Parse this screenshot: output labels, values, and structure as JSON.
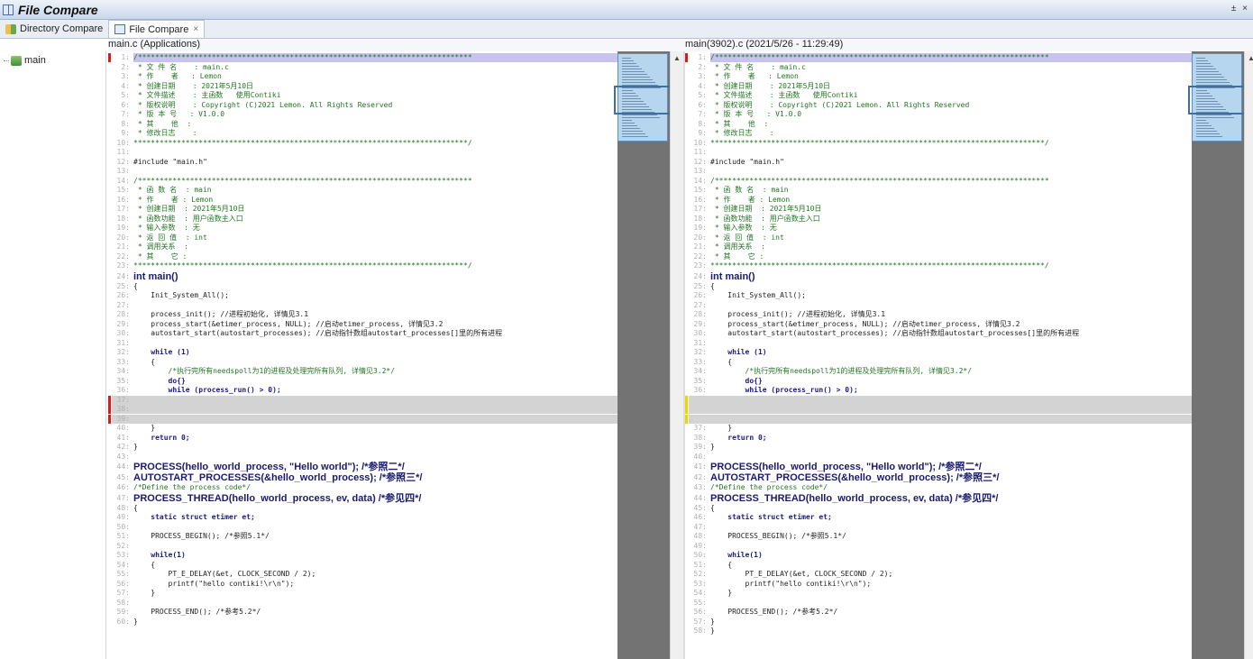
{
  "window": {
    "title": "File Compare",
    "controls": "± ×"
  },
  "tabs": [
    {
      "label": "Directory Compare"
    },
    {
      "label": "File Compare",
      "close": "×"
    }
  ],
  "left_header": "main.c (Applications)",
  "right_header": "main(3902).c (2021/5/26 - 11:29:49)",
  "tree": {
    "root": "main"
  },
  "left_lines": [
    {
      "n": "1:",
      "t": "/*****************************************************************************"
    },
    {
      "n": "2:",
      "t": " * 文 件 名    : main.c"
    },
    {
      "n": "3:",
      "t": " * 作    者   : Lemon"
    },
    {
      "n": "4:",
      "t": " * 创建日期    : 2021年5月10日"
    },
    {
      "n": "5:",
      "t": " * 文件描述    : 主函数   使用Contiki"
    },
    {
      "n": "6:",
      "t": " * 版权说明    : Copyright (C)2021 Lemon. All Rights Reserved"
    },
    {
      "n": "7:",
      "t": " * 版 本 号   : V1.0.0"
    },
    {
      "n": "8:",
      "t": " * 其    他  :"
    },
    {
      "n": "9:",
      "t": " * 修改日志    :"
    },
    {
      "n": "10:",
      "t": "*****************************************************************************/"
    },
    {
      "n": "11:",
      "t": ""
    },
    {
      "n": "12:",
      "t": "#include \"main.h\""
    },
    {
      "n": "13:",
      "t": ""
    },
    {
      "n": "14:",
      "t": "/*****************************************************************************"
    },
    {
      "n": "15:",
      "t": " * 函 数 名  : main"
    },
    {
      "n": "16:",
      "t": " * 作    者 : Lemon"
    },
    {
      "n": "17:",
      "t": " * 创建日期  : 2021年5月10日"
    },
    {
      "n": "18:",
      "t": " * 函数功能  : 用户函数主入口"
    },
    {
      "n": "19:",
      "t": " * 输入参数  : 无"
    },
    {
      "n": "20:",
      "t": " * 返 回 值  : int"
    },
    {
      "n": "21:",
      "t": " * 调用关系  :"
    },
    {
      "n": "22:",
      "t": " * 其    它 :"
    },
    {
      "n": "23:",
      "t": "*****************************************************************************/"
    },
    {
      "n": "24:",
      "t": "int main()"
    },
    {
      "n": "25:",
      "t": "{"
    },
    {
      "n": "26:",
      "t": "    Init_System_All();"
    },
    {
      "n": "27:",
      "t": ""
    },
    {
      "n": "28:",
      "t": "    process_init(); //进程初始化, 详情见3.1"
    },
    {
      "n": "29:",
      "t": "    process_start(&etimer_process, NULL); //启动etimer_process, 详情见3.2"
    },
    {
      "n": "30:",
      "t": "    autostart_start(autostart_processes); //启动指针数组autostart_processes[]里的所有进程"
    },
    {
      "n": "31:",
      "t": ""
    },
    {
      "n": "32:",
      "t": "    while (1)"
    },
    {
      "n": "33:",
      "t": "    {"
    },
    {
      "n": "34:",
      "t": "        /*执行完所有needspoll为1的进程及处理完所有队列, 详情见3.2*/"
    },
    {
      "n": "35:",
      "t": "        do{}"
    },
    {
      "n": "36:",
      "t": "        while (process_run() > 0);"
    },
    {
      "n": "37:",
      "t": ""
    },
    {
      "n": "38:",
      "t": ""
    },
    {
      "n": "39:",
      "t": ""
    },
    {
      "n": "40:",
      "t": "    }"
    },
    {
      "n": "41:",
      "t": "    return 0;"
    },
    {
      "n": "42:",
      "t": "}"
    },
    {
      "n": "43:",
      "t": ""
    },
    {
      "n": "44:",
      "t": "PROCESS(hello_world_process, \"Hello world\"); /*参照二*/"
    },
    {
      "n": "45:",
      "t": "AUTOSTART_PROCESSES(&hello_world_process); /*参照三*/"
    },
    {
      "n": "46:",
      "t": "/*Define the process code*/"
    },
    {
      "n": "47:",
      "t": "PROCESS_THREAD(hello_world_process, ev, data) /*参见四*/"
    },
    {
      "n": "48:",
      "t": "{"
    },
    {
      "n": "49:",
      "t": "    static struct etimer et;"
    },
    {
      "n": "50:",
      "t": ""
    },
    {
      "n": "51:",
      "t": "    PROCESS_BEGIN(); /*参照5.1*/"
    },
    {
      "n": "52:",
      "t": ""
    },
    {
      "n": "53:",
      "t": "    while(1)"
    },
    {
      "n": "54:",
      "t": "    {"
    },
    {
      "n": "55:",
      "t": "        PT_E_DELAY(&et, CLOCK_SECOND / 2);"
    },
    {
      "n": "56:",
      "t": "        printf(\"hello contiki!\\r\\n\");"
    },
    {
      "n": "57:",
      "t": "    }"
    },
    {
      "n": "58:",
      "t": ""
    },
    {
      "n": "59:",
      "t": "    PROCESS_END(); /*参考5.2*/"
    },
    {
      "n": "60:",
      "t": "}"
    }
  ],
  "right_lines": [
    {
      "n": "1:",
      "t": "/*****************************************************************************"
    },
    {
      "n": "2:",
      "t": " * 文 件 名    : main.c"
    },
    {
      "n": "3:",
      "t": " * 作    者   : Lemon"
    },
    {
      "n": "4:",
      "t": " * 创建日期    : 2021年5月10日"
    },
    {
      "n": "5:",
      "t": " * 文件描述    : 主函数   使用Contiki"
    },
    {
      "n": "6:",
      "t": " * 版权说明    : Copyright (C)2021 Lemon. All Rights Reserved"
    },
    {
      "n": "7:",
      "t": " * 版 本 号   : V1.0.0"
    },
    {
      "n": "8:",
      "t": " * 其    他  :"
    },
    {
      "n": "9:",
      "t": " * 修改日志    :"
    },
    {
      "n": "10:",
      "t": "*****************************************************************************/"
    },
    {
      "n": "11:",
      "t": ""
    },
    {
      "n": "12:",
      "t": "#include \"main.h\""
    },
    {
      "n": "13:",
      "t": ""
    },
    {
      "n": "14:",
      "t": "/*****************************************************************************"
    },
    {
      "n": "15:",
      "t": " * 函 数 名  : main"
    },
    {
      "n": "16:",
      "t": " * 作    者 : Lemon"
    },
    {
      "n": "17:",
      "t": " * 创建日期  : 2021年5月10日"
    },
    {
      "n": "18:",
      "t": " * 函数功能  : 用户函数主入口"
    },
    {
      "n": "19:",
      "t": " * 输入参数  : 无"
    },
    {
      "n": "20:",
      "t": " * 返 回 值  : int"
    },
    {
      "n": "21:",
      "t": " * 调用关系  :"
    },
    {
      "n": "22:",
      "t": " * 其    它 :"
    },
    {
      "n": "23:",
      "t": "*****************************************************************************/"
    },
    {
      "n": "24:",
      "t": "int main()"
    },
    {
      "n": "25:",
      "t": "{"
    },
    {
      "n": "26:",
      "t": "    Init_System_All();"
    },
    {
      "n": "27:",
      "t": ""
    },
    {
      "n": "28:",
      "t": "    process_init(); //进程初始化, 详情见3.1"
    },
    {
      "n": "29:",
      "t": "    process_start(&etimer_process, NULL); //启动etimer_process, 详情见3.2"
    },
    {
      "n": "30:",
      "t": "    autostart_start(autostart_processes); //启动指针数组autostart_processes[]里的所有进程"
    },
    {
      "n": "31:",
      "t": ""
    },
    {
      "n": "32:",
      "t": "    while (1)"
    },
    {
      "n": "33:",
      "t": "    {"
    },
    {
      "n": "34:",
      "t": "        /*执行完所有needspoll为1的进程及处理完所有队列, 详情见3.2*/"
    },
    {
      "n": "35:",
      "t": "        do{}"
    },
    {
      "n": "36:",
      "t": "        while (process_run() > 0);"
    },
    {
      "n": "",
      "t": ""
    },
    {
      "n": "",
      "t": ""
    },
    {
      "n": "",
      "t": ""
    },
    {
      "n": "37:",
      "t": "    }"
    },
    {
      "n": "38:",
      "t": "    return 0;"
    },
    {
      "n": "39:",
      "t": "}"
    },
    {
      "n": "40:",
      "t": ""
    },
    {
      "n": "41:",
      "t": "PROCESS(hello_world_process, \"Hello world\"); /*参照二*/"
    },
    {
      "n": "42:",
      "t": "AUTOSTART_PROCESSES(&hello_world_process); /*参照三*/"
    },
    {
      "n": "43:",
      "t": "/*Define the process code*/"
    },
    {
      "n": "44:",
      "t": "PROCESS_THREAD(hello_world_process, ev, data) /*参见四*/"
    },
    {
      "n": "45:",
      "t": "{"
    },
    {
      "n": "46:",
      "t": "    static struct etimer et;"
    },
    {
      "n": "47:",
      "t": ""
    },
    {
      "n": "48:",
      "t": "    PROCESS_BEGIN(); /*参照5.1*/"
    },
    {
      "n": "49:",
      "t": ""
    },
    {
      "n": "50:",
      "t": "    while(1)"
    },
    {
      "n": "51:",
      "t": "    {"
    },
    {
      "n": "52:",
      "t": "        PT_E_DELAY(&et, CLOCK_SECOND / 2);"
    },
    {
      "n": "53:",
      "t": "        printf(\"hello contiki!\\r\\n\");"
    },
    {
      "n": "54:",
      "t": "    }"
    },
    {
      "n": "55:",
      "t": ""
    },
    {
      "n": "56:",
      "t": "    PROCESS_END(); /*参考5.2*/"
    },
    {
      "n": "57:",
      "t": "}"
    },
    {
      "n": "58:",
      "t": "}"
    }
  ],
  "colors": {
    "diff_left": "#cc2222",
    "diff_right": "#e8d800",
    "minimap": "#b6d5ef",
    "gap": "#d3d3d3"
  }
}
